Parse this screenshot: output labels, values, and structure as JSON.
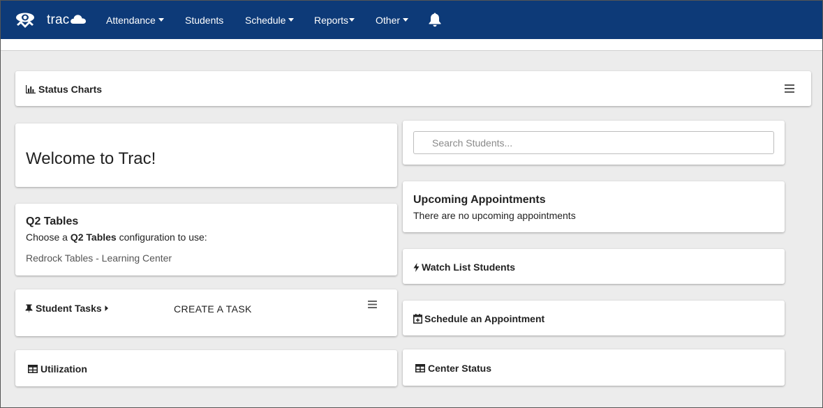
{
  "nav": {
    "brand": "trac",
    "items": [
      {
        "label": "Attendance",
        "dropdown": true
      },
      {
        "label": "Students",
        "dropdown": false
      },
      {
        "label": "Schedule",
        "dropdown": true
      },
      {
        "label": "Reports",
        "dropdown": true
      },
      {
        "label": "Other",
        "dropdown": true
      }
    ],
    "icons": {
      "logo": "trac-logo-icon",
      "cloud": "cloud-icon",
      "bell": "bell-icon"
    }
  },
  "status_charts": {
    "title": "Status Charts",
    "icon": "bar-chart-icon",
    "menu_icon": "hamburger-menu-icon"
  },
  "welcome": {
    "title": "Welcome to Trac!"
  },
  "q2_tables": {
    "title": "Q2 Tables",
    "prefix": "Choose a ",
    "bold": "Q2 Tables",
    "suffix": " configuration to use:",
    "option": "Redrock Tables - Learning Center"
  },
  "student_tasks": {
    "title": "Student Tasks",
    "icon": "pushpin-icon",
    "create_label": "CREATE A TASK",
    "menu_icon": "hamburger-menu-icon"
  },
  "utilization": {
    "title": "Utilization",
    "icon": "table-icon"
  },
  "search": {
    "placeholder": "Search Students...",
    "value": ""
  },
  "appointments": {
    "title": "Upcoming Appointments",
    "empty_text": "There are no upcoming appointments"
  },
  "watch_list": {
    "title": "Watch List Students",
    "icon": "lightning-bolt-icon"
  },
  "schedule_appointment": {
    "title": "Schedule an Appointment",
    "icon": "calendar-plus-icon"
  },
  "center_status": {
    "title": "Center Status",
    "icon": "table-icon"
  },
  "colors": {
    "navbar": "#0d3a78",
    "background": "#ececec",
    "card": "#ffffff"
  }
}
